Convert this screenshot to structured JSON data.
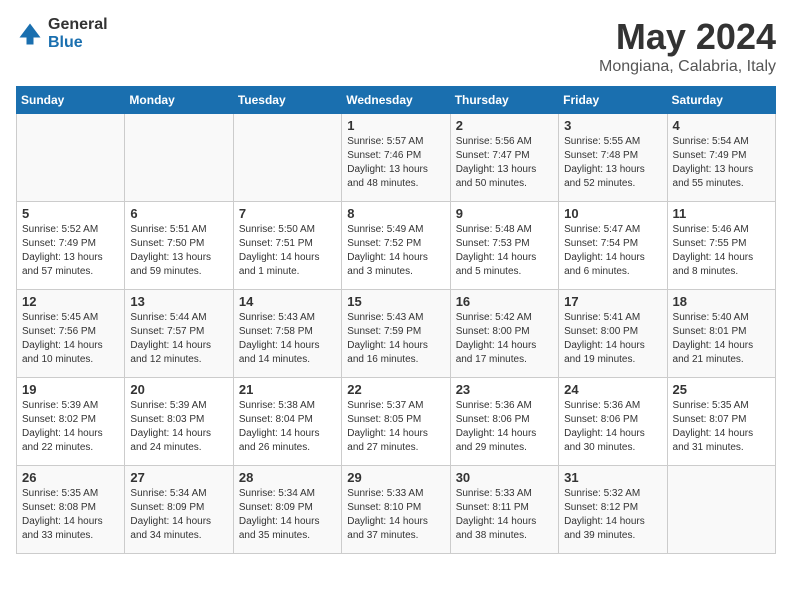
{
  "logo": {
    "general": "General",
    "blue": "Blue"
  },
  "title": "May 2024",
  "location": "Mongiana, Calabria, Italy",
  "days_header": [
    "Sunday",
    "Monday",
    "Tuesday",
    "Wednesday",
    "Thursday",
    "Friday",
    "Saturday"
  ],
  "weeks": [
    [
      {
        "day": "",
        "content": ""
      },
      {
        "day": "",
        "content": ""
      },
      {
        "day": "",
        "content": ""
      },
      {
        "day": "1",
        "content": "Sunrise: 5:57 AM\nSunset: 7:46 PM\nDaylight: 13 hours\nand 48 minutes."
      },
      {
        "day": "2",
        "content": "Sunrise: 5:56 AM\nSunset: 7:47 PM\nDaylight: 13 hours\nand 50 minutes."
      },
      {
        "day": "3",
        "content": "Sunrise: 5:55 AM\nSunset: 7:48 PM\nDaylight: 13 hours\nand 52 minutes."
      },
      {
        "day": "4",
        "content": "Sunrise: 5:54 AM\nSunset: 7:49 PM\nDaylight: 13 hours\nand 55 minutes."
      }
    ],
    [
      {
        "day": "5",
        "content": "Sunrise: 5:52 AM\nSunset: 7:49 PM\nDaylight: 13 hours\nand 57 minutes."
      },
      {
        "day": "6",
        "content": "Sunrise: 5:51 AM\nSunset: 7:50 PM\nDaylight: 13 hours\nand 59 minutes."
      },
      {
        "day": "7",
        "content": "Sunrise: 5:50 AM\nSunset: 7:51 PM\nDaylight: 14 hours\nand 1 minute."
      },
      {
        "day": "8",
        "content": "Sunrise: 5:49 AM\nSunset: 7:52 PM\nDaylight: 14 hours\nand 3 minutes."
      },
      {
        "day": "9",
        "content": "Sunrise: 5:48 AM\nSunset: 7:53 PM\nDaylight: 14 hours\nand 5 minutes."
      },
      {
        "day": "10",
        "content": "Sunrise: 5:47 AM\nSunset: 7:54 PM\nDaylight: 14 hours\nand 6 minutes."
      },
      {
        "day": "11",
        "content": "Sunrise: 5:46 AM\nSunset: 7:55 PM\nDaylight: 14 hours\nand 8 minutes."
      }
    ],
    [
      {
        "day": "12",
        "content": "Sunrise: 5:45 AM\nSunset: 7:56 PM\nDaylight: 14 hours\nand 10 minutes."
      },
      {
        "day": "13",
        "content": "Sunrise: 5:44 AM\nSunset: 7:57 PM\nDaylight: 14 hours\nand 12 minutes."
      },
      {
        "day": "14",
        "content": "Sunrise: 5:43 AM\nSunset: 7:58 PM\nDaylight: 14 hours\nand 14 minutes."
      },
      {
        "day": "15",
        "content": "Sunrise: 5:43 AM\nSunset: 7:59 PM\nDaylight: 14 hours\nand 16 minutes."
      },
      {
        "day": "16",
        "content": "Sunrise: 5:42 AM\nSunset: 8:00 PM\nDaylight: 14 hours\nand 17 minutes."
      },
      {
        "day": "17",
        "content": "Sunrise: 5:41 AM\nSunset: 8:00 PM\nDaylight: 14 hours\nand 19 minutes."
      },
      {
        "day": "18",
        "content": "Sunrise: 5:40 AM\nSunset: 8:01 PM\nDaylight: 14 hours\nand 21 minutes."
      }
    ],
    [
      {
        "day": "19",
        "content": "Sunrise: 5:39 AM\nSunset: 8:02 PM\nDaylight: 14 hours\nand 22 minutes."
      },
      {
        "day": "20",
        "content": "Sunrise: 5:39 AM\nSunset: 8:03 PM\nDaylight: 14 hours\nand 24 minutes."
      },
      {
        "day": "21",
        "content": "Sunrise: 5:38 AM\nSunset: 8:04 PM\nDaylight: 14 hours\nand 26 minutes."
      },
      {
        "day": "22",
        "content": "Sunrise: 5:37 AM\nSunset: 8:05 PM\nDaylight: 14 hours\nand 27 minutes."
      },
      {
        "day": "23",
        "content": "Sunrise: 5:36 AM\nSunset: 8:06 PM\nDaylight: 14 hours\nand 29 minutes."
      },
      {
        "day": "24",
        "content": "Sunrise: 5:36 AM\nSunset: 8:06 PM\nDaylight: 14 hours\nand 30 minutes."
      },
      {
        "day": "25",
        "content": "Sunrise: 5:35 AM\nSunset: 8:07 PM\nDaylight: 14 hours\nand 31 minutes."
      }
    ],
    [
      {
        "day": "26",
        "content": "Sunrise: 5:35 AM\nSunset: 8:08 PM\nDaylight: 14 hours\nand 33 minutes."
      },
      {
        "day": "27",
        "content": "Sunrise: 5:34 AM\nSunset: 8:09 PM\nDaylight: 14 hours\nand 34 minutes."
      },
      {
        "day": "28",
        "content": "Sunrise: 5:34 AM\nSunset: 8:09 PM\nDaylight: 14 hours\nand 35 minutes."
      },
      {
        "day": "29",
        "content": "Sunrise: 5:33 AM\nSunset: 8:10 PM\nDaylight: 14 hours\nand 37 minutes."
      },
      {
        "day": "30",
        "content": "Sunrise: 5:33 AM\nSunset: 8:11 PM\nDaylight: 14 hours\nand 38 minutes."
      },
      {
        "day": "31",
        "content": "Sunrise: 5:32 AM\nSunset: 8:12 PM\nDaylight: 14 hours\nand 39 minutes."
      },
      {
        "day": "",
        "content": ""
      }
    ]
  ]
}
